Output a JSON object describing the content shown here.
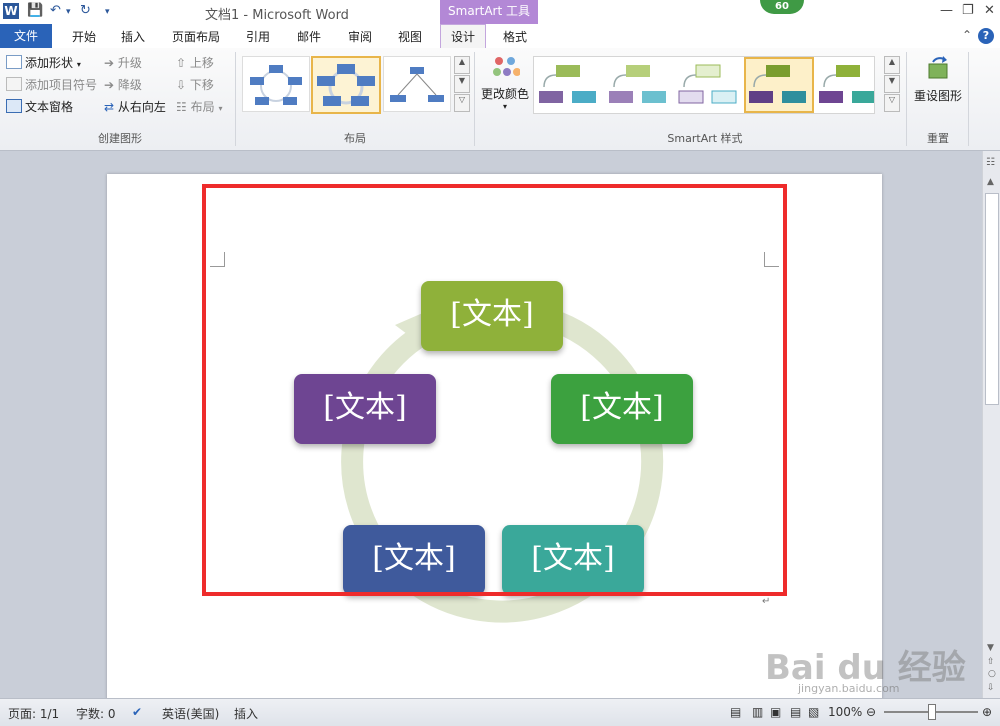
{
  "window": {
    "doc_title": "文档1 - Microsoft Word",
    "context_tools": "SmartArt 工具",
    "badge": "60"
  },
  "tabs": [
    "文件",
    "开始",
    "插入",
    "页面布局",
    "引用",
    "邮件",
    "审阅",
    "视图",
    "设计",
    "格式"
  ],
  "ribbon": {
    "create": {
      "add_shape": "添加形状",
      "add_bullet": "添加项目符号",
      "text_pane": "文本窗格",
      "promote": "升级",
      "demote": "降级",
      "right_to_left": "从右向左",
      "move_up": "上移",
      "move_down": "下移",
      "layout": "布局",
      "label": "创建图形"
    },
    "layouts": {
      "label": "布局"
    },
    "styles": {
      "change_colors": "更改颜色",
      "label": "SmartArt 样式"
    },
    "reset": {
      "reset_graphic": "重设图形",
      "label": "重置"
    }
  },
  "diagram": {
    "nodes": [
      {
        "text": "[文本]",
        "color": "#8fb13a"
      },
      {
        "text": "[文本]",
        "color": "#3ca13f"
      },
      {
        "text": "[文本]",
        "color": "#3aa89a"
      },
      {
        "text": "[文本]",
        "color": "#3f5a9c"
      },
      {
        "text": "[文本]",
        "color": "#6e4592"
      }
    ],
    "cycle_color": "#dfe6cf",
    "frame_color": "#ee2b2b"
  },
  "status": {
    "page": "页面: 1/1",
    "words": "字数: 0",
    "language": "英语(美国)",
    "mode": "插入",
    "zoom": "100%"
  },
  "watermark": {
    "brand": "Bai du 经验",
    "url": "jingyan.baidu.com"
  }
}
